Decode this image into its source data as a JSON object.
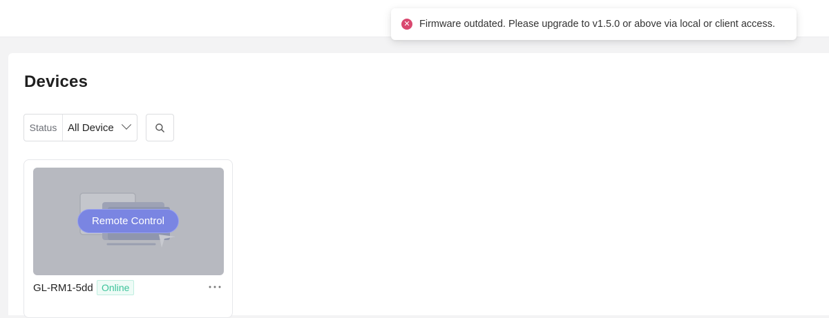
{
  "page": {
    "title": "Devices"
  },
  "filter": {
    "label": "Status",
    "value": "All Device"
  },
  "search": {
    "icon": "search-icon"
  },
  "devices": [
    {
      "name": "GL-RM1-5dd",
      "status": "Online",
      "action_label": "Remote Control",
      "more_icon": "more-horizontal-icon"
    }
  ],
  "toast": {
    "type": "error",
    "icon": "error-circle-icon",
    "message": "Firmware outdated. Please upgrade to v1.5.0 or above via local or client access."
  },
  "colors": {
    "accent": "#7a85e2",
    "online": "#3cc39a",
    "error": "#d9486f",
    "preview_bg": "#b7b9c0"
  }
}
